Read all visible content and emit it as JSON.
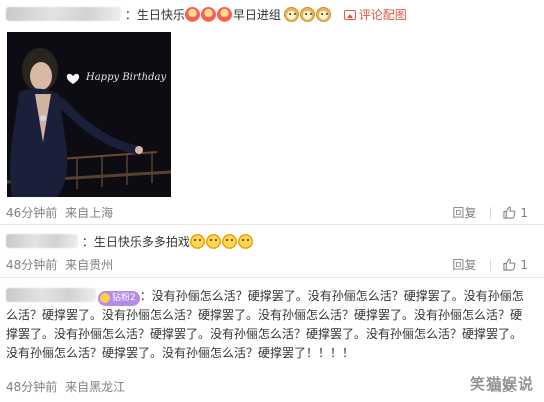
{
  "comments": [
    {
      "text": "：生日快乐",
      "text2": "早日进组",
      "view_image_label": "评论配图",
      "time": "46分钟前",
      "location": "来自上海",
      "reply_label": "回复",
      "likes": "1",
      "image_text": "Happy Birthday"
    },
    {
      "text": "：生日快乐多多拍戏",
      "time": "48分钟前",
      "location": "来自贵州",
      "reply_label": "回复",
      "likes": "1"
    },
    {
      "badge": "钻粉2",
      "text": "：没有孙俪怎么活？硬撑罢了。没有孙俪怎么活？硬撑罢了。没有孙俪怎么活？硬撑罢了。没有孙俪怎么活？硬撑罢了。没有孙俪怎么活？硬撑罢了。没有孙俪怎么活？硬撑罢了。没有孙俪怎么活？硬撑罢了。没有孙俪怎么活？硬撑罢了。没有孙俪怎么活？硬撑罢了。没有孙俪怎么活？硬撑罢了。没有孙俪怎么活？硬撑罢了！！！！",
      "time": "48分钟前",
      "location": "来自黑龙江",
      "reply_label": "回复"
    }
  ],
  "watermark": "笑猫娱说",
  "colors": {
    "link": "#e5543d",
    "meta": "#808080",
    "badge": "#b58ae8"
  }
}
